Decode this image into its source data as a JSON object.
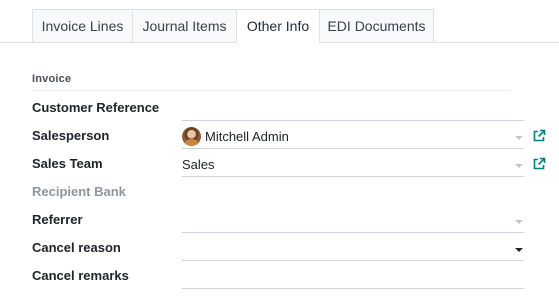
{
  "tabs": [
    {
      "label": "Invoice Lines",
      "active": false
    },
    {
      "label": "Journal Items",
      "active": false
    },
    {
      "label": "Other Info",
      "active": true
    },
    {
      "label": "EDI Documents",
      "active": false
    }
  ],
  "section": {
    "title": "Invoice"
  },
  "fields": {
    "customer_reference": {
      "label": "Customer Reference",
      "value": ""
    },
    "salesperson": {
      "label": "Salesperson",
      "value": "Mitchell Admin",
      "icon": "external-link-icon"
    },
    "sales_team": {
      "label": "Sales Team",
      "value": "Sales",
      "icon": "external-link-icon"
    },
    "recipient_bank": {
      "label": "Recipient Bank",
      "value": ""
    },
    "referrer": {
      "label": "Referrer",
      "value": ""
    },
    "cancel_reason": {
      "label": "Cancel reason",
      "value": ""
    },
    "cancel_remarks": {
      "label": "Cancel remarks",
      "value": ""
    }
  },
  "colors": {
    "link_accent": "#017e84",
    "label_muted": "#8f959b",
    "border": "#dee2e6"
  }
}
